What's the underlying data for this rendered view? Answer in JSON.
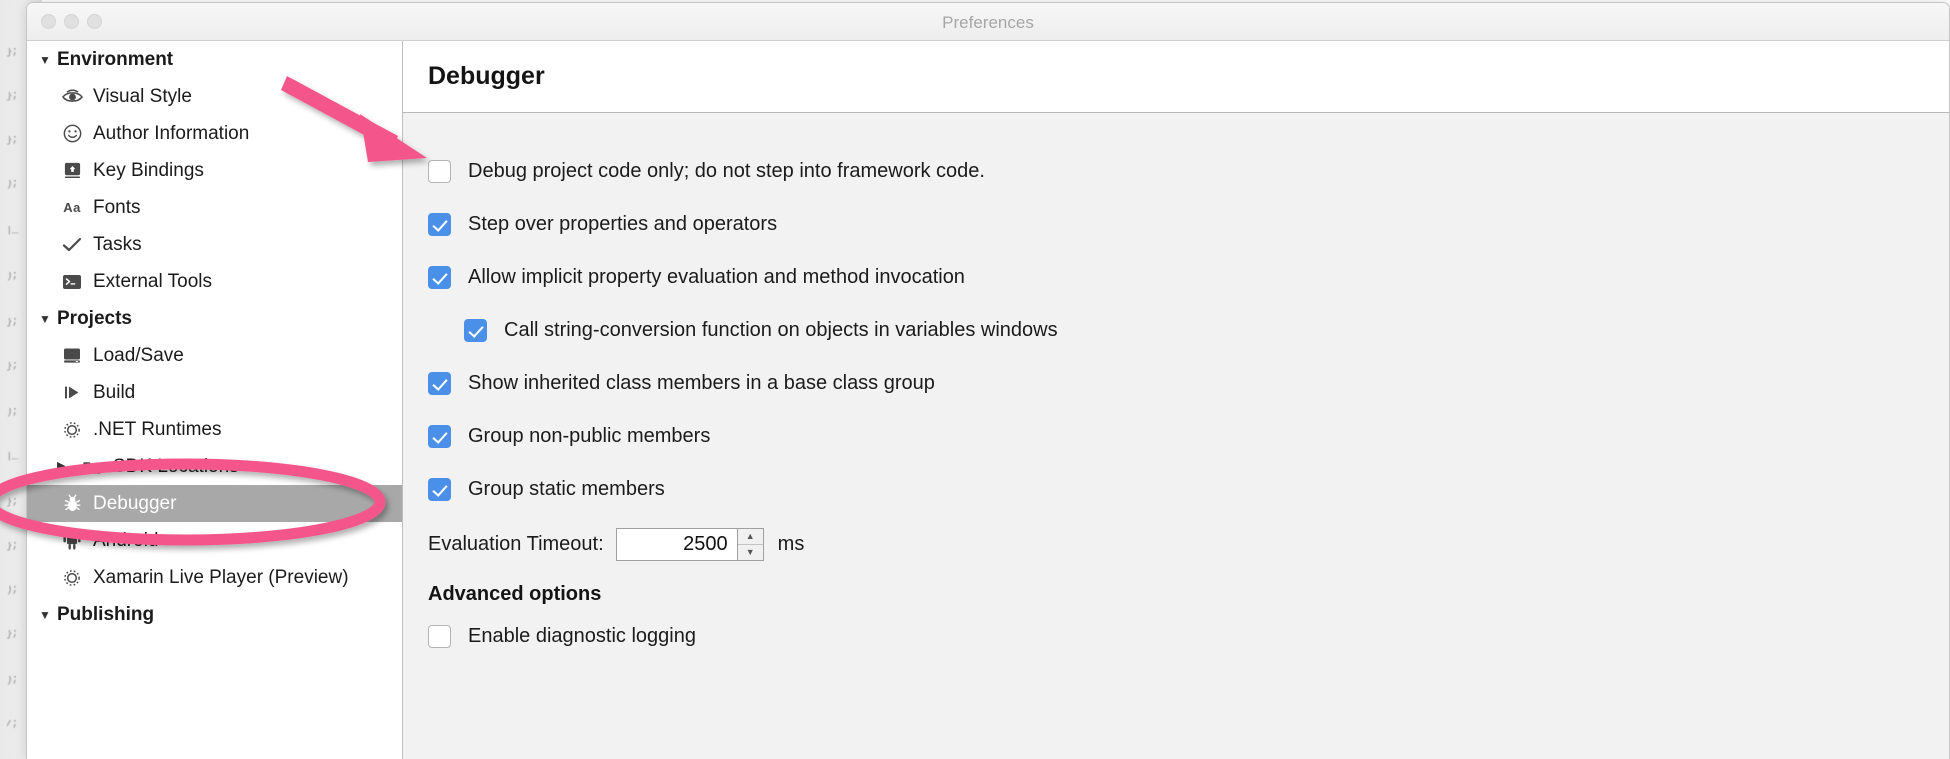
{
  "window": {
    "title": "Preferences",
    "traffic_lights": [
      "close-button",
      "minimize-button",
      "zoom-button"
    ]
  },
  "sidebar": {
    "groups": [
      {
        "label": "Environment",
        "expanded": true,
        "items": [
          {
            "label": "Visual Style",
            "icon": "eye-icon"
          },
          {
            "label": "Author Information",
            "icon": "smiley-icon"
          },
          {
            "label": "Key Bindings",
            "icon": "keyboard-icon"
          },
          {
            "label": "Fonts",
            "icon": "aa-text-icon"
          },
          {
            "label": "Tasks",
            "icon": "checkmark-icon"
          },
          {
            "label": "External Tools",
            "icon": "terminal-icon"
          }
        ]
      },
      {
        "label": "Projects",
        "expanded": true,
        "items": [
          {
            "label": "Load/Save",
            "icon": "disk-icon"
          },
          {
            "label": "Build",
            "icon": "play-icon"
          },
          {
            "label": ".NET Runtimes",
            "icon": "gear-icon"
          },
          {
            "label": "SDK Locations",
            "icon": "folder-icon",
            "has_disclosure": true
          },
          {
            "label": "Debugger",
            "icon": "bug-icon",
            "selected": true
          },
          {
            "label": "Android",
            "icon": "android-icon"
          },
          {
            "label": "Xamarin Live Player (Preview)",
            "icon": "gear-icon"
          }
        ]
      },
      {
        "label": "Publishing",
        "expanded": true,
        "items": []
      }
    ]
  },
  "main": {
    "title": "Debugger",
    "options": [
      {
        "label": "Debug project code only; do not step into framework code.",
        "checked": false,
        "indent": false
      },
      {
        "label": "Step over properties and operators",
        "checked": true,
        "indent": false
      },
      {
        "label": "Allow implicit property evaluation and method invocation",
        "checked": true,
        "indent": false
      },
      {
        "label": "Call string-conversion function on objects in variables windows",
        "checked": true,
        "indent": true
      },
      {
        "label": "Show inherited class members in a base class group",
        "checked": true,
        "indent": false
      },
      {
        "label": "Group non-public members",
        "checked": true,
        "indent": false
      },
      {
        "label": "Group static members",
        "checked": true,
        "indent": false
      }
    ],
    "timeout": {
      "label": "Evaluation Timeout:",
      "value": "2500",
      "unit": "ms",
      "stepper_up": "▲",
      "stepper_down": "▼"
    },
    "advanced": {
      "title": "Advanced options",
      "options": [
        {
          "label": "Enable diagnostic logging",
          "checked": false,
          "indent": false
        }
      ]
    }
  },
  "annotations": {
    "color": "#F4578C",
    "arrow": "arrow-pointing-to-first-checkbox",
    "ellipse": "ellipse-around-debugger-sidebar-item"
  }
}
